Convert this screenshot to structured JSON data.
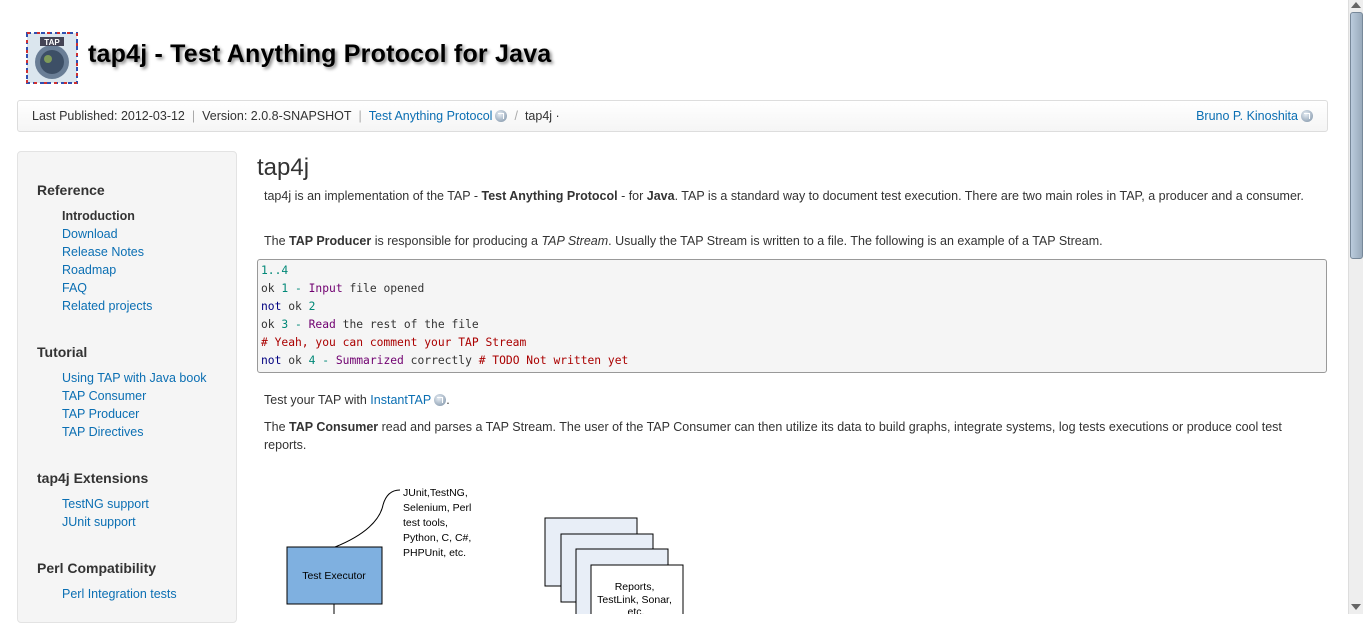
{
  "header": {
    "title": "tap4j - Test Anything Protocol for Java",
    "logo_icon": "tap-logo-icon",
    "logo_text": "TAP"
  },
  "bar": {
    "published": "Last Published: 2012-03-12",
    "version": "Version: 2.0.8-SNAPSHOT",
    "link_tap": "Test Anything Protocol",
    "crumb_tap4j": "tap4j ·",
    "author": "Bruno P. Kinoshita"
  },
  "sidebar": {
    "sections": [
      {
        "title": "Reference",
        "items": [
          "Introduction",
          "Download",
          "Release Notes",
          "Roadmap",
          "FAQ",
          "Related projects"
        ]
      },
      {
        "title": "Tutorial",
        "items": [
          "Using TAP with Java book",
          "TAP Consumer",
          "TAP Producer",
          "TAP Directives"
        ]
      },
      {
        "title": "tap4j Extensions",
        "items": [
          "TestNG support",
          "JUnit support"
        ]
      },
      {
        "title": "Perl Compatibility",
        "items": [
          "Perl Integration tests"
        ]
      }
    ]
  },
  "content": {
    "heading": "tap4j",
    "p1a": "tap4j is an implementation of the TAP - ",
    "p1b": "Test Anything Protocol",
    "p1c": " - for ",
    "p1d": "Java",
    "p1e": ". TAP is a standard way to document test execution. There are two main roles in TAP, a producer and a consumer.",
    "p2a": "The ",
    "p2b": "TAP Producer",
    "p2c": " is responsible for producing a ",
    "p2d": "TAP Stream",
    "p2e": ". Usually the TAP Stream is written to a file. The following is an example of a TAP Stream.",
    "code": {
      "l1": "1..4",
      "l2a": "ok ",
      "l2b": "1",
      "l2c": " - ",
      "l2d": "Input",
      "l2e": " file opened",
      "l3a": "not",
      "l3b": " ok ",
      "l3c": "2",
      "l4a": "ok ",
      "l4b": "3",
      "l4c": " - ",
      "l4d": "Read",
      "l4e": " the rest of the file",
      "l5": "# Yeah, you can comment your TAP Stream",
      "l6a": "not",
      "l6b": " ok ",
      "l6c": "4",
      "l6d": " - ",
      "l6e": "Summarized",
      "l6f": " correctly ",
      "l6g": "# TODO Not written yet"
    },
    "p3a": "Test your TAP with ",
    "p3b": "InstantTAP",
    "p3c": ".",
    "p4a": "The ",
    "p4b": "TAP Consumer",
    "p4c": " read and parses a TAP Stream. The user of the TAP Consumer can then utilize its data to build graphs, integrate systems, log tests executions or produce cool test reports."
  },
  "diagram": {
    "tools_label": [
      "JUnit,TestNG,",
      "Selenium, Perl",
      "test tools,",
      "Python, C, C#,",
      "PHPUnit, etc."
    ],
    "executor_label": "Test Executor",
    "reports_label": [
      "Reports,",
      "TestLink, Sonar,",
      "etc."
    ]
  },
  "colors": {
    "link": "#0b6fb3",
    "diagram_blue": "#7fb0e0"
  }
}
